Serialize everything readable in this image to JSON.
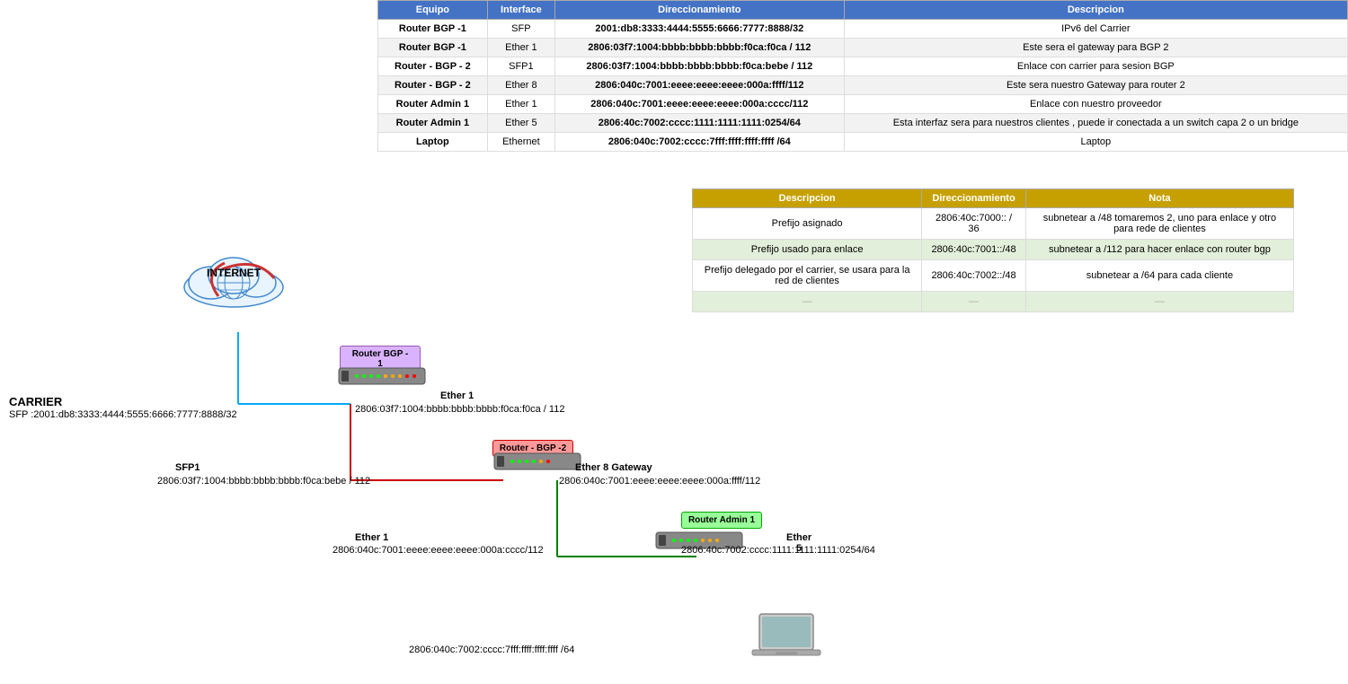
{
  "mainTable": {
    "headers": [
      "Equipo",
      "Interface",
      "Direccionamiento",
      "Descripcion"
    ],
    "rows": [
      [
        "Router BGP -1",
        "SFP",
        "2001:db8:3333:4444:5555:6666:7777:8888/32",
        "IPv6 del Carrier"
      ],
      [
        "Router BGP -1",
        "Ether 1",
        "2806:03f7:1004:bbbb:bbbb:bbbb:f0ca:f0ca / 112",
        "Este sera el gateway para BGP 2"
      ],
      [
        "Router - BGP - 2",
        "SFP1",
        "2806:03f7:1004:bbbb:bbbb:bbbb:f0ca:bebe / 112",
        "Enlace con carrier para sesion BGP"
      ],
      [
        "Router - BGP - 2",
        "Ether 8",
        "2806:040c:7001:eeee:eeee:eeee:000a:ffff/112",
        "Este sera nuestro Gateway para router 2"
      ],
      [
        "Router Admin 1",
        "Ether 1",
        "2806:040c:7001:eeee:eeee:eeee:000a:cccc/112",
        "Enlace con nuestro proveedor"
      ],
      [
        "Router Admin 1",
        "Ether 5",
        "2806:40c:7002:cccc:1111:1111:1111:0254/64",
        "Esta interfaz sera para nuestros clientes , puede ir conectada a un switch capa 2 o un bridge"
      ],
      [
        "Laptop",
        "Ethernet",
        "2806:040c:7002:cccc:7fff:ffff:ffff:ffff /64",
        "Laptop"
      ]
    ]
  },
  "secondaryTable": {
    "headers": [
      "Descripcion",
      "Direccionamiento",
      "Nota"
    ],
    "rows": [
      [
        "Prefijo asignado",
        "2806:40c:7000:: / 36",
        "subnetear a /48  tomaremos 2, uno para enlace y otro para rede de clientes"
      ],
      [
        "Prefijo usado para enlace",
        "2806:40c:7001::/48",
        "subnetear a /112 para hacer enlace con router bgp"
      ],
      [
        "Prefijo delegado por el carrier, se usara para la red de clientes",
        "2806:40c:7002::/48",
        "subnetear a /64 para cada cliente"
      ],
      [
        "—",
        "—",
        "—"
      ]
    ]
  },
  "diagram": {
    "internetLabel": "INTERNET",
    "carrierLabel": "CARRIER",
    "carrierSFP": "SFP :2001:db8:3333:4444:5555:6666:7777:8888/32",
    "routerBGP1Label": "Router BGP -\n1",
    "routerBGP2Label": "Router - BGP -2",
    "routerAdmin1Label": "Router Admin 1",
    "laptopLabel": "Laptop",
    "ether1Label": "Ether 1",
    "ether1Addr": "2806:03f7:1004:bbbb:bbbb:bbbb:f0ca:f0ca / 112",
    "sfp1Label": "SFP1",
    "sfp1Addr": "2806:03f7:1004:bbbb:bbbb:bbbb:f0ca:bebe / 112",
    "ether1Admin": "Ether 1",
    "ether1AdminAddr": "2806:040c:7001:eeee:eeee:eeee:000a:cccc/112",
    "ether8Label": "Ether 8 Gateway",
    "ether8Addr": "2806:040c:7001:eeee:eeee:eeee:000a:ffff/112",
    "ether5Label": "Ether 5",
    "ether5Addr": "2806:40c:7002:cccc:1111:1111:1111:0254/64",
    "laptopAddrLabel": "2806:040c:7002:cccc:7fff:ffff:ffff:ffff /64"
  }
}
